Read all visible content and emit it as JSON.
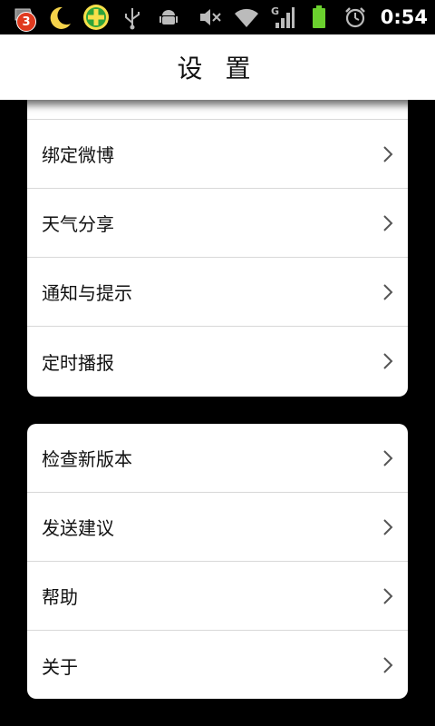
{
  "status_bar": {
    "notification_count": "3",
    "icons_left": [
      "app-notification-icon",
      "moon-icon",
      "360-plus-icon",
      "usb-icon",
      "android-debug-icon"
    ],
    "icons_right": [
      "mute-icon",
      "wifi-icon",
      "signal-icon",
      "battery-icon",
      "alarm-icon"
    ],
    "network_label": "G",
    "time": "0:54",
    "colors": {
      "battery": "#6bd12e",
      "badge": "#e03a1f",
      "plus_icon": "#2ea43a"
    }
  },
  "header": {
    "title": "设 置"
  },
  "groups": [
    {
      "items": [
        {
          "label": "绑定微博"
        },
        {
          "label": "天气分享"
        },
        {
          "label": "通知与提示"
        },
        {
          "label": "定时播报"
        }
      ]
    },
    {
      "items": [
        {
          "label": "检查新版本"
        },
        {
          "label": "发送建议"
        },
        {
          "label": "帮助"
        },
        {
          "label": "关于"
        }
      ]
    }
  ]
}
